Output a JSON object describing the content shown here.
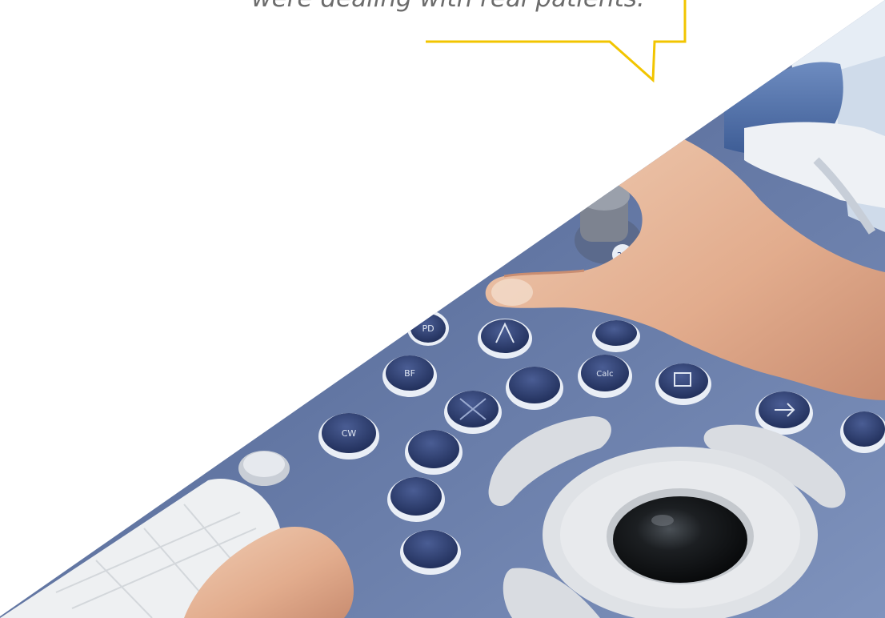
{
  "quote": {
    "text": "were dealing with real patients."
  },
  "colors": {
    "background": "#ffffff",
    "bubble_outline": "#f2c500",
    "console_blue": "#5a6e9a",
    "console_light": "#aebcd6",
    "button_dark": "#2d3f73",
    "button_rim": "#e9eef6",
    "pad_gray": "#d6d9de",
    "trackball": "#121416",
    "skin": "#e7b99d",
    "skin_shadow": "#c98d71",
    "keyboard": "#eef0f2"
  },
  "photo": {
    "subject": "hands operating an ultrasound machine console",
    "button_icon_names": [
      "pd-button-icon",
      "bf-button-icon",
      "cw-button-icon",
      "calc-button-icon",
      "probe-button-icon",
      "freeze-button-icon",
      "arrow-button-icon",
      "2d-knob-icon"
    ]
  }
}
